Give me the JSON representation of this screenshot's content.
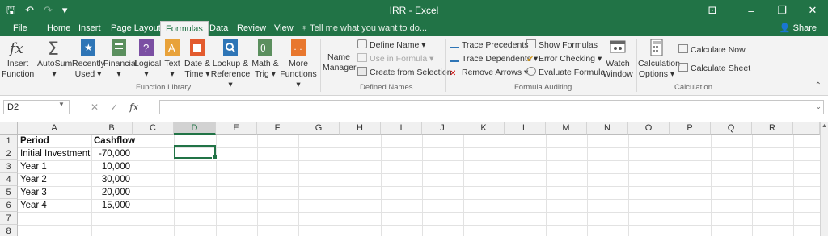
{
  "window": {
    "title": "IRR - Excel",
    "controls": {
      "ribbon_options": "⊡",
      "minimize": "–",
      "restore": "❐",
      "close": "✕"
    }
  },
  "qat": {
    "save": "🖫",
    "undo": "↶",
    "redo": "↷",
    "customize": "▾"
  },
  "tabs": [
    "File",
    "Home",
    "Insert",
    "Page Layout",
    "Formulas",
    "Data",
    "Review",
    "View"
  ],
  "active_tab": "Formulas",
  "tell_me": "♀ Tell me what you want to do...",
  "share": "Share",
  "ribbon": {
    "function_library": {
      "label": "Function Library",
      "buttons": [
        {
          "line1": "Insert",
          "line2": "Function",
          "icon": "fx-icon"
        },
        {
          "line1": "AutoSum",
          "line2": "▾",
          "icon": "sigma-icon"
        },
        {
          "line1": "Recently",
          "line2": "Used ▾",
          "icon": "star-book-icon"
        },
        {
          "line1": "Financial",
          "line2": "▾",
          "icon": "financial-book-icon"
        },
        {
          "line1": "Logical",
          "line2": "▾",
          "icon": "logical-book-icon"
        },
        {
          "line1": "Text",
          "line2": "▾",
          "icon": "text-book-icon"
        },
        {
          "line1": "Date &",
          "line2": "Time ▾",
          "icon": "calendar-book-icon"
        },
        {
          "line1": "Lookup &",
          "line2": "Reference ▾",
          "icon": "lookup-book-icon"
        },
        {
          "line1": "Math &",
          "line2": "Trig ▾",
          "icon": "math-book-icon"
        },
        {
          "line1": "More",
          "line2": "Functions ▾",
          "icon": "more-book-icon"
        }
      ]
    },
    "defined_names": {
      "label": "Defined Names",
      "name_manager": {
        "line1": "Name",
        "line2": "Manager"
      },
      "define_name": "Define Name ▾",
      "use_in_formula": "Use in Formula ▾",
      "create_from_selection": "Create from Selection"
    },
    "formula_auditing": {
      "label": "Formula Auditing",
      "trace_precedents": "Trace Precedents",
      "trace_dependents": "Trace Dependents ▾",
      "remove_arrows": "Remove Arrows ▾",
      "show_formulas": "Show Formulas",
      "error_checking": "Error Checking ▾",
      "evaluate_formula": "Evaluate Formula",
      "watch_window": {
        "line1": "Watch",
        "line2": "Window"
      }
    },
    "calculation": {
      "label": "Calculation",
      "calculation_options": {
        "line1": "Calculation",
        "line2": "Options ▾"
      },
      "calculate_now": "Calculate Now",
      "calculate_sheet": "Calculate Sheet"
    }
  },
  "formula_bar": {
    "name_box": "D2",
    "cancel": "✕",
    "enter": "✓",
    "fx": "fx",
    "content": ""
  },
  "sheet": {
    "columns": [
      "A",
      "B",
      "C",
      "D",
      "E",
      "F",
      "G",
      "H",
      "I",
      "J",
      "K",
      "L",
      "M",
      "N",
      "O",
      "P",
      "Q",
      "R"
    ],
    "selected_column": "D",
    "rows": [
      "1",
      "2",
      "3",
      "4",
      "5",
      "6",
      "7",
      "8"
    ],
    "headers": {
      "A": "Period",
      "B": "Cashflow"
    },
    "data": [
      {
        "period": "Initial Investment",
        "cashflow": "-70,000"
      },
      {
        "period": "Year 1",
        "cashflow": "10,000"
      },
      {
        "period": "Year 2",
        "cashflow": "30,000"
      },
      {
        "period": "Year 3",
        "cashflow": "20,000"
      },
      {
        "period": "Year 4",
        "cashflow": "15,000"
      }
    ],
    "active_cell": "D2"
  },
  "colors": {
    "accent": "#217346",
    "ribbon_bg": "#f3f3f3"
  }
}
